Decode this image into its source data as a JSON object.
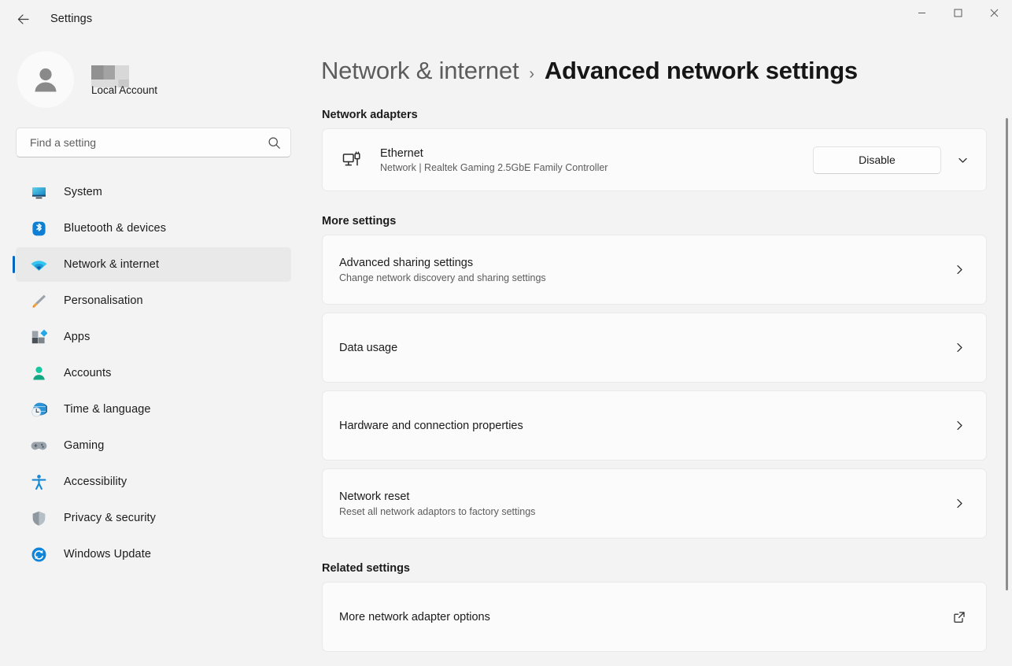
{
  "window": {
    "title": "Settings",
    "back_label": "Back",
    "controls": {
      "minimize": "Minimize",
      "maximize": "Maximize",
      "close": "Close"
    }
  },
  "sidebar": {
    "profile": {
      "name_redacted": "",
      "account_type": "Local Account"
    },
    "search": {
      "placeholder": "Find a setting",
      "value": ""
    },
    "items": [
      {
        "label": "System",
        "icon": "monitor-icon",
        "active": false
      },
      {
        "label": "Bluetooth & devices",
        "icon": "bluetooth-icon",
        "active": false
      },
      {
        "label": "Network & internet",
        "icon": "wifi-icon",
        "active": true
      },
      {
        "label": "Personalisation",
        "icon": "paintbrush-icon",
        "active": false
      },
      {
        "label": "Apps",
        "icon": "apps-icon",
        "active": false
      },
      {
        "label": "Accounts",
        "icon": "person-icon",
        "active": false
      },
      {
        "label": "Time & language",
        "icon": "clock-globe-icon",
        "active": false
      },
      {
        "label": "Gaming",
        "icon": "gamepad-icon",
        "active": false
      },
      {
        "label": "Accessibility",
        "icon": "accessibility-icon",
        "active": false
      },
      {
        "label": "Privacy & security",
        "icon": "shield-icon",
        "active": false
      },
      {
        "label": "Windows Update",
        "icon": "refresh-icon",
        "active": false
      }
    ]
  },
  "main": {
    "breadcrumb": {
      "parent": "Network & internet",
      "separator": "›",
      "current": "Advanced network settings"
    },
    "sections": {
      "network_adapters": {
        "title": "Network adapters",
        "adapter": {
          "icon": "ethernet-icon",
          "name": "Ethernet",
          "subtitle": "Network | Realtek Gaming 2.5GbE Family Controller",
          "action_label": "Disable",
          "expand_icon": "chevron-down-icon"
        }
      },
      "more_settings": {
        "title": "More settings",
        "items": [
          {
            "title": "Advanced sharing settings",
            "subtitle": "Change network discovery and sharing settings",
            "trailing_icon": "chevron-right-icon"
          },
          {
            "title": "Data usage",
            "subtitle": "",
            "trailing_icon": "chevron-right-icon"
          },
          {
            "title": "Hardware and connection properties",
            "subtitle": "",
            "trailing_icon": "chevron-right-icon"
          },
          {
            "title": "Network reset",
            "subtitle": "Reset all network adaptors to factory settings",
            "trailing_icon": "chevron-right-icon"
          }
        ]
      },
      "related_settings": {
        "title": "Related settings",
        "items": [
          {
            "title": "More network adapter options",
            "subtitle": "",
            "trailing_icon": "external-link-icon"
          }
        ]
      }
    }
  },
  "colors": {
    "page_background": "#f3f3f3",
    "card_background": "#fbfbfb",
    "accent": "#0067c0",
    "text_primary": "#1b1b1b",
    "text_secondary": "#5c5c5c",
    "card_border": "#e9e9e9"
  }
}
